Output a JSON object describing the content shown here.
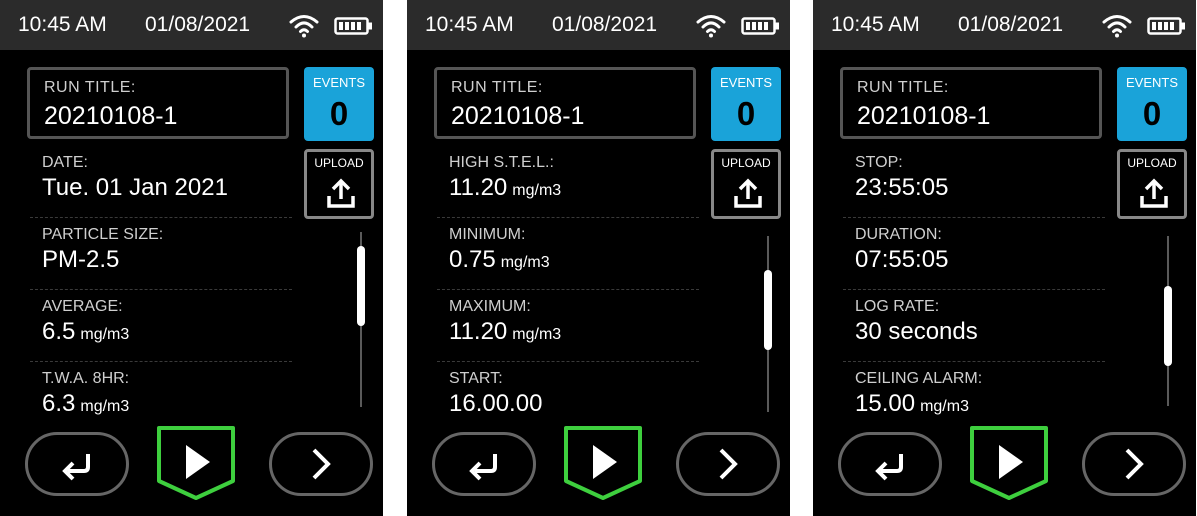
{
  "screens": [
    {
      "status": {
        "time": "10:45 AM",
        "date": "01/08/2021"
      },
      "run_title": {
        "label": "RUN TITLE:",
        "value": "20210108-1"
      },
      "events": {
        "label": "EVENTS",
        "count": "0"
      },
      "upload": {
        "label": "UPLOAD"
      },
      "rows": [
        {
          "label": "DATE:",
          "value": "Tue. 01 Jan 2021",
          "unit": ""
        },
        {
          "label": "PARTICLE SIZE:",
          "value": "PM-2.5",
          "unit": ""
        },
        {
          "label": "AVERAGE:",
          "value": "6.5",
          "unit": "mg/m3"
        },
        {
          "label": "T.W.A. 8HR:",
          "value": "6.3",
          "unit": "mg/m3"
        }
      ],
      "scroll_position": 0.15
    },
    {
      "status": {
        "time": "10:45 AM",
        "date": "01/08/2021"
      },
      "run_title": {
        "label": "RUN TITLE:",
        "value": "20210108-1"
      },
      "events": {
        "label": "EVENTS",
        "count": "0"
      },
      "upload": {
        "label": "UPLOAD"
      },
      "rows": [
        {
          "label": "HIGH S.T.E.L.:",
          "value": "11.20",
          "unit": "mg/m3"
        },
        {
          "label": "MINIMUM:",
          "value": "0.75",
          "unit": "mg/m3"
        },
        {
          "label": "MAXIMUM:",
          "value": "11.20",
          "unit": "mg/m3"
        },
        {
          "label": "START:",
          "value": "16.00.00",
          "unit": ""
        }
      ],
      "scroll_position": 0.35
    },
    {
      "status": {
        "time": "10:45 AM",
        "date": "01/08/2021"
      },
      "run_title": {
        "label": "RUN TITLE:",
        "value": "20210108-1"
      },
      "events": {
        "label": "EVENTS",
        "count": "0"
      },
      "upload": {
        "label": "UPLOAD"
      },
      "rows": [
        {
          "label": "STOP:",
          "value": "23:55:05",
          "unit": ""
        },
        {
          "label": "DURATION:",
          "value": "07:55:05",
          "unit": ""
        },
        {
          "label": "LOG RATE:",
          "value": "30 seconds",
          "unit": ""
        },
        {
          "label": "CEILING ALARM:",
          "value": "15.00",
          "unit": "mg/m3"
        }
      ],
      "scroll_position": 0.55
    }
  ],
  "colors": {
    "accent_blue": "#1aa3d9",
    "play_green": "#3ecf3e",
    "background": "#000000",
    "statusbar": "#2b2b2b"
  },
  "icons": [
    "wifi-icon",
    "battery-icon",
    "upload-icon",
    "back-arrow-icon",
    "play-icon",
    "chevron-right-icon"
  ]
}
